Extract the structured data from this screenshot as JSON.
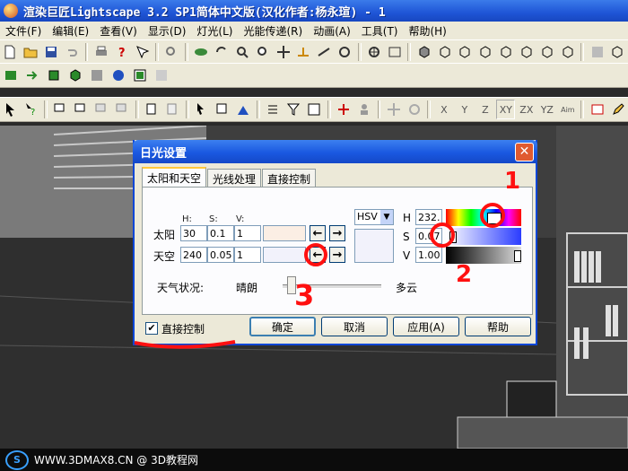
{
  "app": {
    "title": "渲染巨匠Lightscape 3.2 SP1简体中文版(汉化作者:杨永瑄) - 1"
  },
  "menu": [
    "文件(F)",
    "编辑(E)",
    "查看(V)",
    "显示(D)",
    "灯光(L)",
    "光能传递(R)",
    "动画(A)",
    "工具(T)",
    "帮助(H)"
  ],
  "toolbar_axes": [
    "X",
    "Y",
    "Z",
    "XY",
    "ZX",
    "YZ",
    "Aim"
  ],
  "dialog": {
    "title": "日光设置",
    "tabs": [
      "太阳和天空",
      "光线处理",
      "直接控制"
    ],
    "col_h": "H:",
    "col_s": "S:",
    "col_v": "V:",
    "sun_label": "太阳",
    "sky_label": "天空",
    "sun": {
      "h": "30",
      "s": "0.1",
      "v": "1"
    },
    "sky": {
      "h": "240",
      "s": "0.05",
      "v": "1"
    },
    "sun_color": "#fbeee4",
    "sky_color": "#f2f2fb",
    "mode": "HSV",
    "picker_h_label": "H",
    "picker_s_label": "S",
    "picker_v_label": "V",
    "picker_h": "232.",
    "picker_s": "0.07",
    "picker_v": "1.00",
    "weather_label": "天气状况:",
    "weather_clear": "晴朗",
    "weather_cloudy": "多云",
    "weather_level": 0.05,
    "direct_control_label": "直接控制",
    "direct_control_checked": true,
    "ok": "确定",
    "cancel": "取消",
    "apply": "应用(A)",
    "help": "帮助"
  },
  "annotations": [
    "1",
    "2",
    "3"
  ],
  "footer": {
    "logo": "S",
    "text": "WWW.3DMAX8.CN @ 3D教程网"
  }
}
